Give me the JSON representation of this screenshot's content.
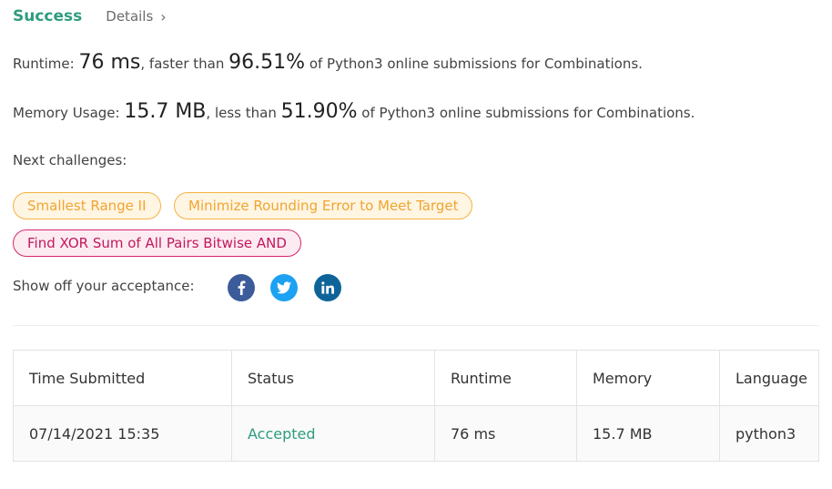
{
  "header": {
    "status": "Success",
    "details_label": "Details",
    "details_chevron": "›"
  },
  "runtime": {
    "label": "Runtime:",
    "value": "76 ms",
    "comparison": ", faster than",
    "percent": "96.51%",
    "suffix": "of Python3 online submissions for Combinations."
  },
  "memory": {
    "label": "Memory Usage:",
    "value": "15.7 MB",
    "comparison": ", less than",
    "percent": "51.90%",
    "suffix": "of Python3 online submissions for Combinations."
  },
  "next_challenges": {
    "label": "Next challenges:",
    "items": [
      {
        "title": "Smallest Range II",
        "difficulty": "medium"
      },
      {
        "title": "Minimize Rounding Error to Meet Target",
        "difficulty": "medium"
      },
      {
        "title": "Find XOR Sum of All Pairs Bitwise AND",
        "difficulty": "hard"
      }
    ]
  },
  "share": {
    "label": "Show off your acceptance:",
    "icons": [
      "facebook-icon",
      "twitter-icon",
      "linkedin-icon"
    ]
  },
  "submissions_table": {
    "headers": [
      "Time Submitted",
      "Status",
      "Runtime",
      "Memory",
      "Language"
    ],
    "rows": [
      {
        "time": "07/14/2021 15:35",
        "status": "Accepted",
        "runtime": "76 ms",
        "memory": "15.7 MB",
        "language": "python3"
      }
    ]
  },
  "colors": {
    "success": "#2f9c7e",
    "medium_chip": "#f0a531",
    "hard_chip": "#c2185b",
    "facebook": "#3b5b9a",
    "twitter": "#1da1f2",
    "linkedin": "#0e6499"
  }
}
